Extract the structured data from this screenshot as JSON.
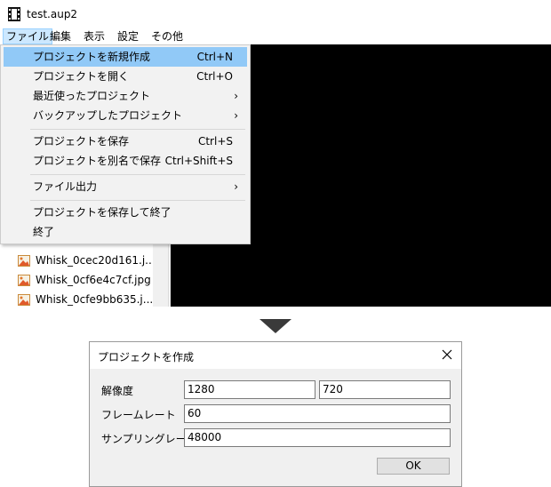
{
  "window": {
    "title": "test.aup2"
  },
  "menubar": {
    "items": [
      {
        "label": "ファイル"
      },
      {
        "label": "編集"
      },
      {
        "label": "表示"
      },
      {
        "label": "設定"
      },
      {
        "label": "その他"
      }
    ]
  },
  "file_menu": {
    "items": [
      {
        "label": "プロジェクトを新規作成",
        "shortcut": "Ctrl+N"
      },
      {
        "label": "プロジェクトを開く",
        "shortcut": "Ctrl+O"
      },
      {
        "label": "最近使ったプロジェクト",
        "submenu": "›"
      },
      {
        "label": "バックアップしたプロジェクト",
        "submenu": "›"
      },
      {
        "label": "プロジェクトを保存",
        "shortcut": "Ctrl+S"
      },
      {
        "label": "プロジェクトを別名で保存",
        "shortcut": "Ctrl+Shift+S"
      },
      {
        "label": "ファイル出力",
        "submenu": "›"
      },
      {
        "label": "プロジェクトを保存して終了"
      },
      {
        "label": "終了"
      }
    ]
  },
  "file_list": {
    "items": [
      {
        "name": "Whisk_0cec20d161.j..."
      },
      {
        "name": "Whisk_0cf6e4c7cf.jpg"
      },
      {
        "name": "Whisk_0cfe9bb635.j..."
      }
    ]
  },
  "dialog": {
    "title": "プロジェクトを作成",
    "resolution_label": "解像度",
    "width_value": "1280",
    "height_value": "720",
    "framerate_label": "フレームレート",
    "framerate_value": "60",
    "samplerate_label": "サンプリングレート",
    "samplerate_value": "48000",
    "ok_label": "OK"
  },
  "colors": {
    "menu_highlight": "#91c9f7",
    "preview_bg": "#000000",
    "menubar_active": "#cce8ff"
  }
}
